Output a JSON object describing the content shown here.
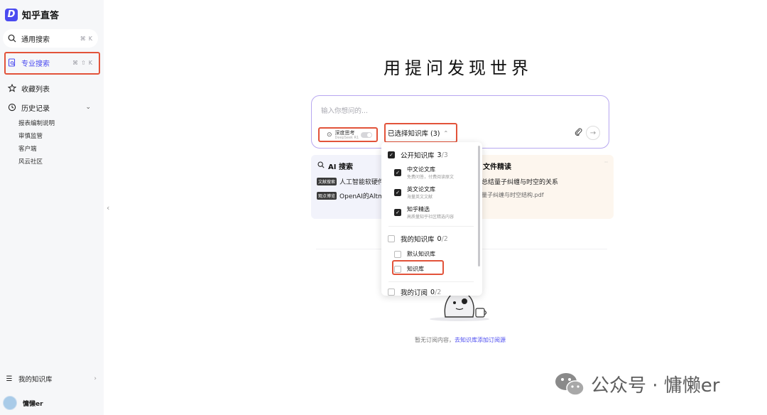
{
  "app": {
    "logo_letter": "D",
    "name": "知乎直答"
  },
  "sidebar": {
    "general_search": {
      "label": "通用搜索",
      "shortcut": [
        "⌘",
        "K"
      ]
    },
    "pro_search": {
      "label": "专业搜索",
      "shortcut": [
        "⌘",
        "⇧",
        "K"
      ]
    },
    "favorites": {
      "label": "收藏列表"
    },
    "history": {
      "label": "历史记录",
      "items": [
        "报表编制说明",
        "审慎监管",
        "客户端",
        "风云社区"
      ]
    },
    "my_kb": {
      "label": "我的知识库"
    },
    "user": {
      "name": "慵懒er"
    },
    "collapse_glyph": "‹"
  },
  "main": {
    "headline": "用提问发现世界",
    "ask": {
      "placeholder": "输入你想问的...",
      "deep_think": {
        "label": "深度思考",
        "sub": "DeepSeek R1"
      },
      "kb_selector": {
        "label": "已选择知识库 (3)"
      }
    },
    "cards": {
      "ai": {
        "title": "AI 搜索",
        "lines": [
          {
            "tag": "文献搜索",
            "text": "人工智能软硬件"
          },
          {
            "tag": "观点博览",
            "text": "OpenAI的Altm"
          }
        ]
      },
      "file": {
        "title": "文件精读",
        "lines": [
          "总结量子纠缠与时空的关系",
          "量子纠缠与时空结构.pdf"
        ],
        "more": "··"
      }
    },
    "dropdown": {
      "public": {
        "label": "公开知识库",
        "count": "3",
        "total": "/3"
      },
      "items": [
        {
          "name": "中文论文库",
          "desc": "免费问答，付费阅读原文"
        },
        {
          "name": "英文论文库",
          "desc": "海量英文文献"
        },
        {
          "name": "知乎精选",
          "desc": "高质量知乎社区精选内容"
        }
      ],
      "mine": {
        "label": "我的知识库",
        "count": "0",
        "total": "/2"
      },
      "mine_items": [
        {
          "name": "默认知识库"
        },
        {
          "name": "知识库"
        }
      ],
      "subs": {
        "label": "我的订阅",
        "count": "0",
        "total": "/2"
      }
    },
    "empty": {
      "text": "暂无订阅内容，",
      "link": "去知识库添加订阅源"
    }
  },
  "watermark": {
    "text": "公众号 · 慵懒er"
  },
  "colors": {
    "accent": "#4b4bf0",
    "highlight": "#e2533a",
    "sidebar_bg": "#f6f7f9",
    "ask_border": "#b7a7f0"
  }
}
